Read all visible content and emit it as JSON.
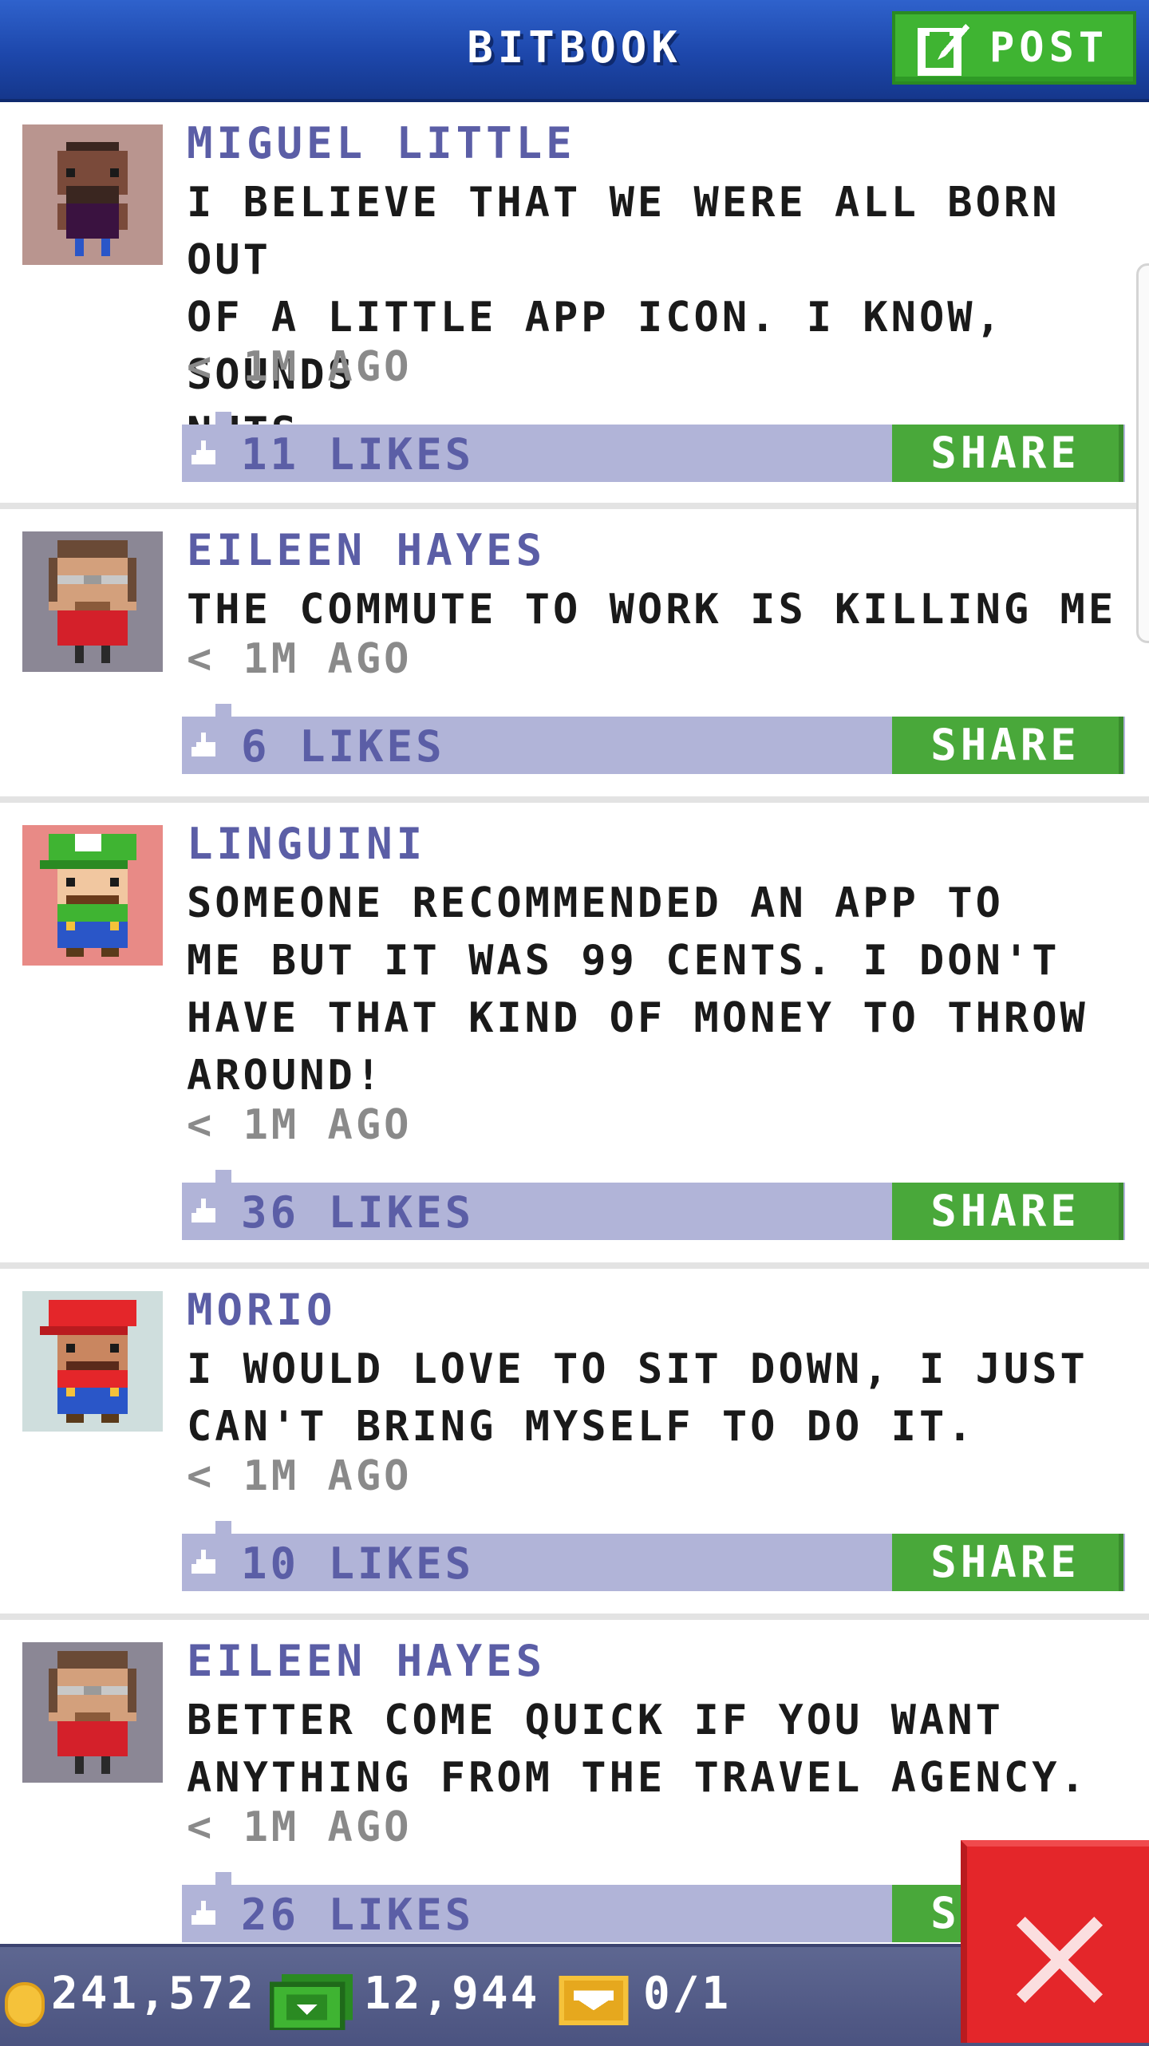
{
  "header": {
    "title": "BITBOOK",
    "post_label": "POST",
    "post_icon": "compose-icon"
  },
  "posts": [
    {
      "author": "MIGUEL LITTLE",
      "message": "I BELIEVE THAT WE WERE ALL BORN OUT\nOF A LITTLE APP ICON. I KNOW, SOUNDS\nNUTS.",
      "time": "< 1M AGO",
      "likes": "11 LIKES",
      "share_label": "SHARE",
      "avatar_bg": "#b9958f"
    },
    {
      "author": "EILEEN HAYES",
      "message": "THE COMMUTE TO WORK IS KILLING ME :(",
      "time": "< 1M AGO",
      "likes": "6 LIKES",
      "share_label": "SHARE",
      "avatar_bg": "#8b8795"
    },
    {
      "author": "LINGUINI",
      "message": "SOMEONE RECOMMENDED AN APP TO\nME BUT IT WAS 99 CENTS. I DON'T\nHAVE THAT KIND OF MONEY TO THROW\nAROUND!",
      "time": "< 1M AGO",
      "likes": "36 LIKES",
      "share_label": "SHARE",
      "avatar_bg": "#e88a86"
    },
    {
      "author": "MORIO",
      "message": "I WOULD LOVE TO SIT DOWN, I JUST\nCAN'T BRING MYSELF TO DO IT.",
      "time": "< 1M AGO",
      "likes": "10 LIKES",
      "share_label": "SHARE",
      "avatar_bg": "#cfdedd"
    },
    {
      "author": "EILEEN HAYES",
      "message": "BETTER COME QUICK IF YOU WANT\nANYTHING FROM THE TRAVEL AGENCY.",
      "time": "< 1M AGO",
      "likes": "26 LIKES",
      "share_label": "SHARE",
      "avatar_bg": "#8b8795"
    }
  ],
  "status_bar": {
    "coins": "241,572",
    "bux": "12,944",
    "tickets": "0/1"
  },
  "colors": {
    "header_blue": "#1d47ab",
    "accent_green": "#49a83a",
    "like_bar": "#b1b4d8",
    "name_purple": "#5b5ea6",
    "close_red": "#e4262a"
  }
}
